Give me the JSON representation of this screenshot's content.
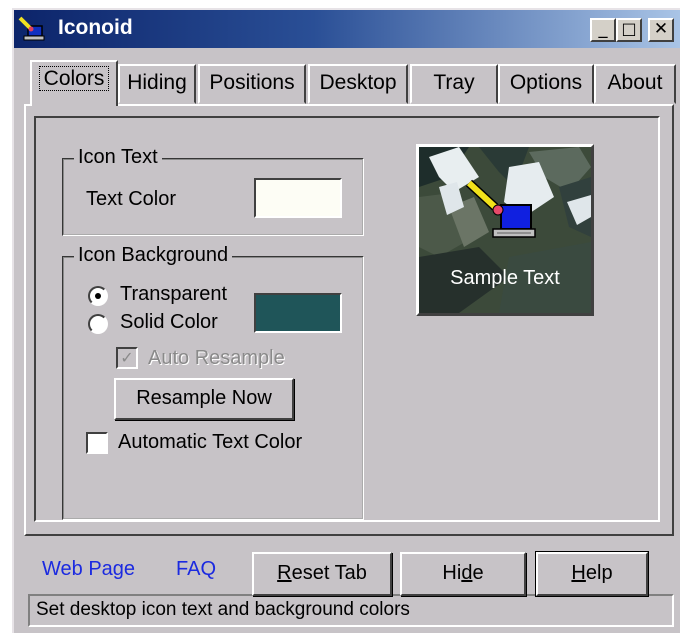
{
  "window": {
    "title": "Iconoid",
    "controls": {
      "minimize": "_",
      "maximize": "□",
      "close": "✕"
    }
  },
  "tabs": [
    {
      "label": "Colors",
      "active": true
    },
    {
      "label": "Hiding",
      "active": false
    },
    {
      "label": "Positions",
      "active": false
    },
    {
      "label": "Desktop",
      "active": false
    },
    {
      "label": "Tray",
      "active": false
    },
    {
      "label": "Options",
      "active": false
    },
    {
      "label": "About",
      "active": false
    }
  ],
  "icon_text_group": {
    "legend": "Icon Text",
    "text_color_label": "Text Color",
    "text_color_value": "#fdfdf5"
  },
  "icon_background_group": {
    "legend": "Icon Background",
    "transparent_label": "Transparent",
    "transparent_selected": true,
    "solid_color_label": "Solid Color",
    "solid_color_selected": false,
    "solid_color_value": "#1f5559",
    "auto_resample_label": "Auto Resample",
    "auto_resample_checked": true,
    "auto_resample_enabled": false,
    "resample_now_label": "Resample Now",
    "automatic_text_color_label": "Automatic Text Color",
    "automatic_text_color_checked": false
  },
  "preview": {
    "sample_text": "Sample Text"
  },
  "footer": {
    "web_page_link": "Web Page",
    "faq_link": "FAQ",
    "reset_tab_prefix": "",
    "reset_tab_mnemonic": "R",
    "reset_tab_suffix": "eset Tab",
    "hide_prefix": "Hi",
    "hide_mnemonic": "d",
    "hide_suffix": "e",
    "help_prefix": "",
    "help_mnemonic": "H",
    "help_suffix": "elp"
  },
  "status_bar": {
    "text": "Set desktop icon text and background colors"
  },
  "colors": {
    "face": "#c7c3c7",
    "title_dark": "#0c246a",
    "link": "#1b2ae0"
  }
}
